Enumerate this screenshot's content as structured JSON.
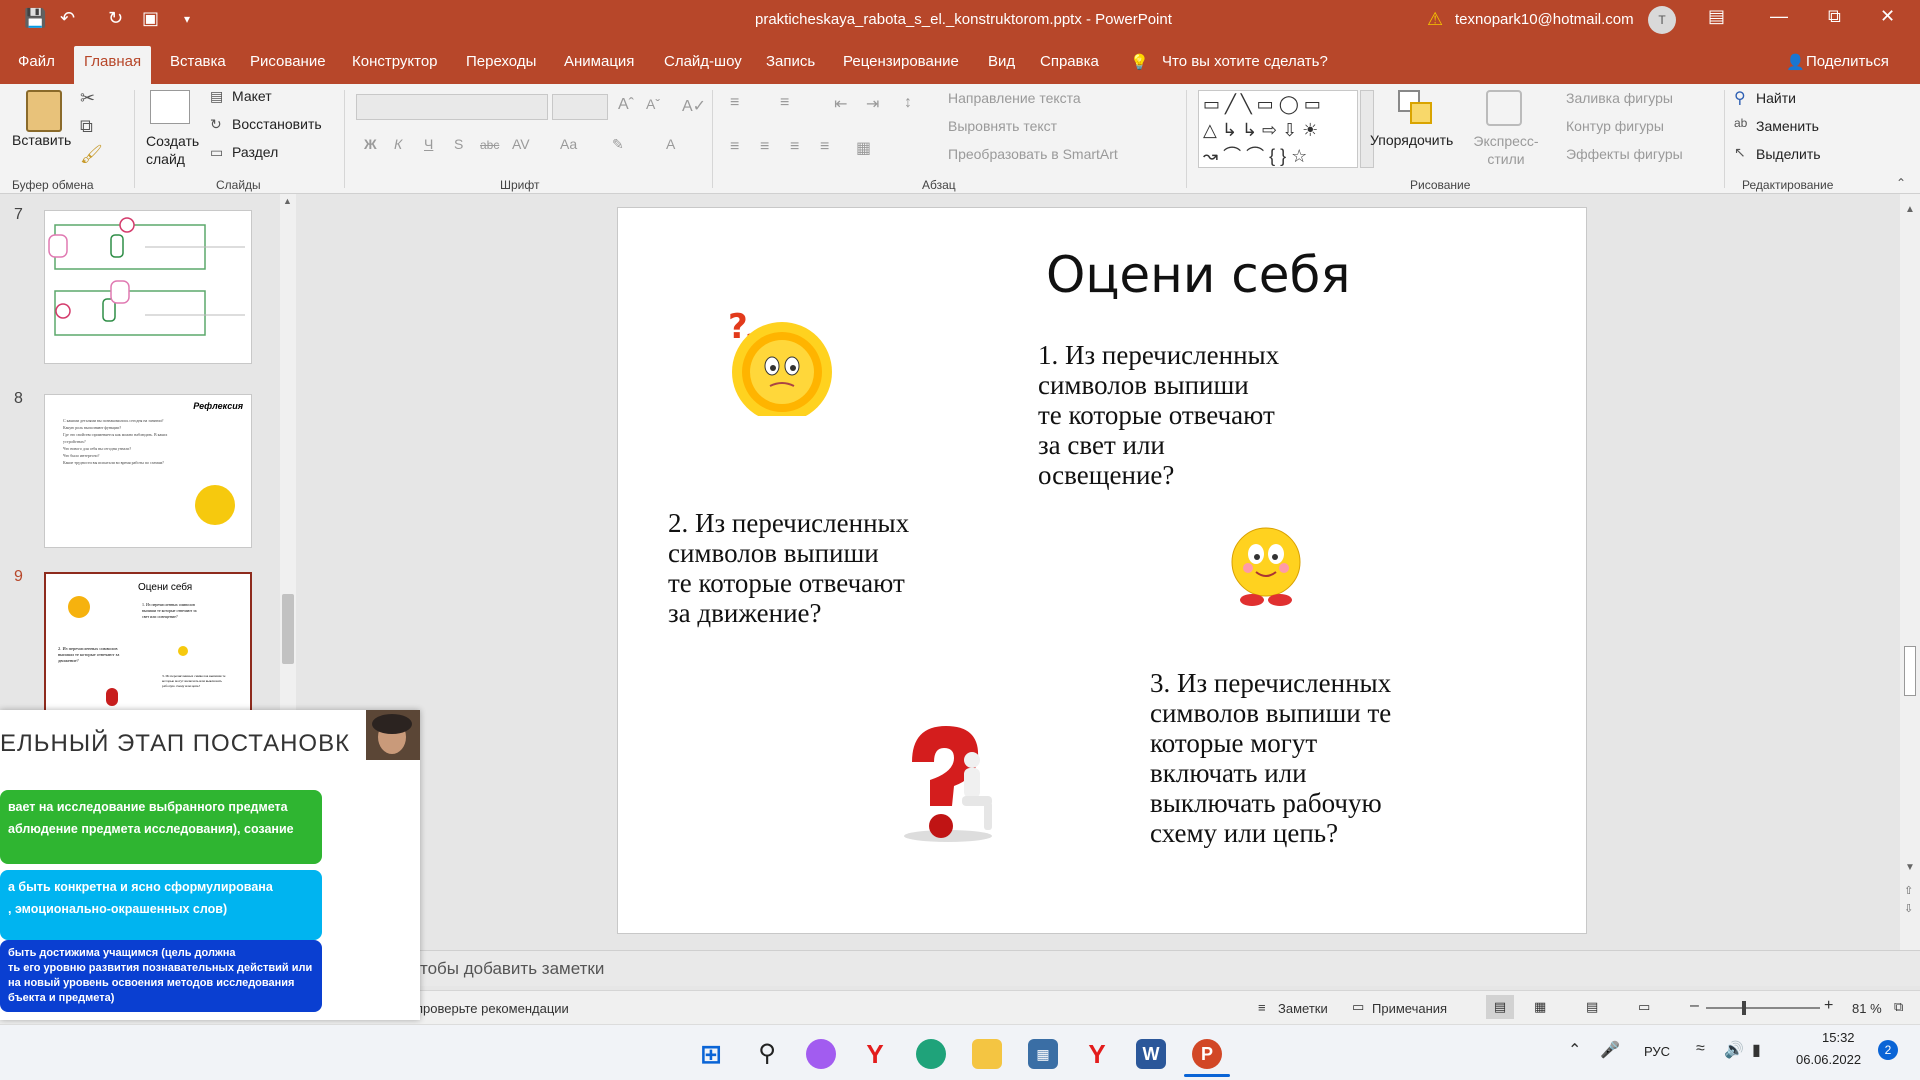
{
  "window": {
    "title": "prakticheskaya_rabota_s_el._konstruktorom.pptx  -  PowerPoint",
    "account": "texnopark10@hotmail.com",
    "avatar_initial": "T",
    "brand_color": "#b7472a"
  },
  "tabs": [
    "Файл",
    "Главная",
    "Вставка",
    "Рисование",
    "Конструктор",
    "Переходы",
    "Анимация",
    "Слайд-шоу",
    "Запись",
    "Рецензирование",
    "Вид",
    "Справка"
  ],
  "active_tab": "Главная",
  "tell_me": "Что вы хотите сделать?",
  "share": "Поделиться",
  "ribbon": {
    "clipboard": {
      "paste": "Вставить",
      "label": "Буфер обмена"
    },
    "slides": {
      "new_slide": "Создать слайд",
      "layout": "Макет",
      "reset": "Восстановить",
      "section": "Раздел",
      "label": "Слайды"
    },
    "font": {
      "bold": "Ж",
      "italic": "К",
      "underline": "Ч",
      "shadow": "S",
      "strike": "abc",
      "spacing": "AV",
      "case": "Aa",
      "color": "A",
      "label": "Шрифт"
    },
    "paragraph": {
      "text_direction": "Направление текста",
      "align_text": "Выровнять текст",
      "smartart": "Преобразовать в SmartArt",
      "label": "Абзац"
    },
    "drawing": {
      "arrange": "Упорядочить",
      "quick_styles": "Экспресс-стили",
      "fill": "Заливка фигуры",
      "outline": "Контур фигуры",
      "effects": "Эффекты фигуры",
      "label": "Рисование"
    },
    "editing": {
      "find": "Найти",
      "replace": "Заменить",
      "select": "Выделить",
      "label": "Редактирование"
    }
  },
  "thumbnails": [
    {
      "num": "7"
    },
    {
      "num": "8",
      "title": "Рефлексия",
      "lines": [
        "С какими деталями вы познакомились сегодня на занятии?",
        "Какую роль выполняют функции?",
        "Где это свойство применяется как можно наблюдать. В каких устройствах?",
        "Что нового для себя вы сегодня узнали?",
        "Что было интересно?",
        "Какие трудности вы испытали во время работы по схемам?"
      ]
    },
    {
      "num": "9",
      "title": "Оцени себя",
      "lines_q1": "1. Из перечисленных символов выпиши те которые отвечают за свет или освещение?",
      "lines_q2": "2. Из перечисленных символов выпиши те которые отвечают за движение?",
      "lines_q3": "3. Из перечисленных символов выпиши те которые могут включать или выключать рабочую схему или цепь?"
    }
  ],
  "slide": {
    "title": "Оцени себя",
    "q1": "1. Из перечисленных\n      символов выпиши\n      те которые отвечают\n      за свет или\n      освещение?",
    "q2": "2. Из перечисленных\n      символов выпиши\n      те которые отвечают\n      за движение?",
    "q3": "3. Из перечисленных\n      символов выпиши те\n      которые могут\n      включать или\n      выключать рабочую\n      схему или цепь?"
  },
  "notes_placeholder": "тобы добавить заметки",
  "overlay": {
    "title": "ЕЛЬНЫЙ  ЭТАП ПОСТАНОВК",
    "box1": "вает на исследование выбранного предмета\nаблюдение предмета исследования), созание",
    "box2": "а быть конкретна  и ясно сформулирована\n, эмоционально-окрашенных слов)",
    "box3": "быть достижима учащимся (цель должна\nть его уровню развития познавательных  действий или\nна новый уровень освоения методов исследования\nбъекта и предмета)",
    "colors": {
      "green": "#2fb531",
      "cyan": "#00b4f0",
      "blue": "#0a3fd1"
    }
  },
  "status": {
    "left_text": "проверьте рекомендации",
    "notes": "Заметки",
    "comments": "Примечания",
    "zoom": "81 %"
  },
  "taskbar": {
    "lang": "РУС",
    "time": "15:32",
    "date": "06.06.2022",
    "badge": "2"
  }
}
